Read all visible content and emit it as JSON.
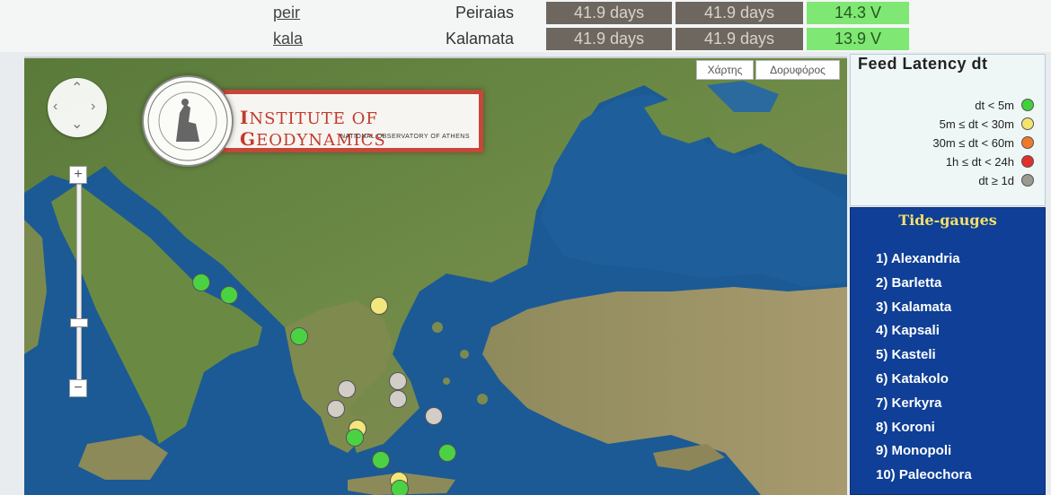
{
  "stations": [
    {
      "code": "peir",
      "name": "Peiraias",
      "latency_a": "41.9 days",
      "latency_b": "41.9 days",
      "voltage": "14.3 V"
    },
    {
      "code": "kala",
      "name": "Kalamata",
      "latency_a": "41.9 days",
      "latency_b": "41.9 days",
      "voltage": "13.9 V"
    }
  ],
  "map": {
    "type_map": "Χάρτης",
    "type_satellite": "Δορυφόρος",
    "zoom_in": "+",
    "zoom_out": "−",
    "logo_title_1": "I",
    "logo_title_2": "NSTITUTE OF ",
    "logo_title_3": "G",
    "logo_title_4": "EODYNAMICS",
    "logo_subtitle": "NATIONAL OBSERVATORY OF ATHENS"
  },
  "legend": {
    "title": "Feed Latency dt",
    "items": [
      {
        "label": "dt < 5m",
        "color": "#3fd23a"
      },
      {
        "label": "5m ≤ dt < 30m",
        "color": "#f3e46e"
      },
      {
        "label": "30m ≤ dt <  60m",
        "color": "#f07a2a"
      },
      {
        "label": "1h ≤ dt <  24h",
        "color": "#e0302a"
      },
      {
        "label": "dt  ≥ 1d",
        "color": "#9a9a90"
      }
    ]
  },
  "tide_gauges": {
    "title": "Tide-gauges",
    "items": [
      "1) Alexandria",
      "2) Barletta",
      "3) Kalamata",
      "4) Kapsali",
      "5) Kasteli",
      "6) Katakolo",
      "7) Kerkyra",
      "8) Koroni",
      "9) Monopoli",
      "10) Paleochora"
    ]
  }
}
